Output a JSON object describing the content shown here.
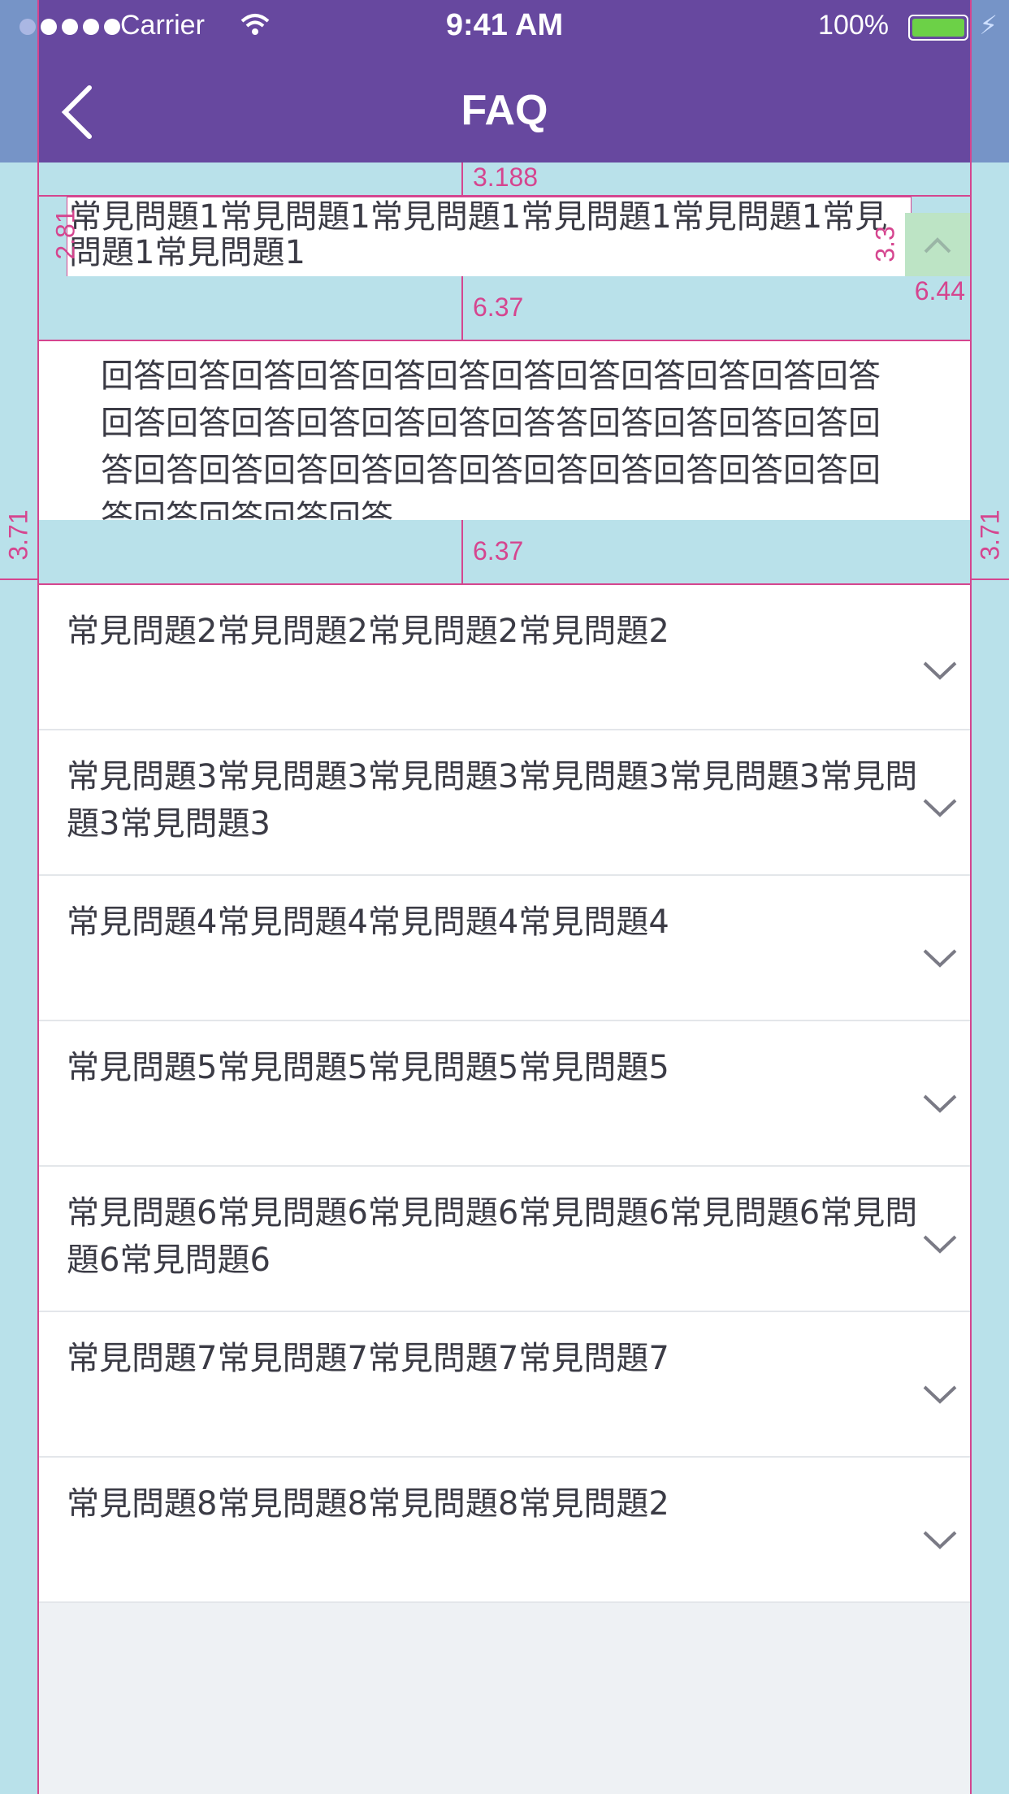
{
  "status_bar": {
    "carrier": "Carrier",
    "time": "9:41 AM",
    "battery": "100%"
  },
  "nav": {
    "title": "FAQ"
  },
  "icons": {
    "back": "chevron-left-icon",
    "wifi": "wifi-icon",
    "expand": "chevron-down-icon",
    "collapse": "chevron-up-icon",
    "charging": "bolt-icon"
  },
  "colors": {
    "header": "#67489f",
    "guide": "#b9e1ea",
    "measure": "#d5458f",
    "text": "#3b3b45"
  },
  "measures": {
    "top_gap": "3.188",
    "left_pad": "2.81",
    "right_pad": "3.3",
    "btn_gap": "6.44",
    "band1": "6.37",
    "band2": "6.37",
    "side_l": "3.71",
    "side_r": "3.71"
  },
  "faq": {
    "open_question": "常見問題1常見問題1常見問題1常見問題1常見問題1常見問題1常見問題1",
    "answer": "回答回答回答回答回答回答回答回答回答回答回答回答回答回答回答回答回答回答回答答回答回答回答回答回答回答回答回答回答回答回答回答回答回答回答回答回答回答回答回答回答",
    "items": [
      "常見問題2常見問題2常見問題2常見問題2",
      "常見問題3常見問題3常見問題3常見問題3常見問題3常見問題3常見問題3",
      "常見問題4常見問題4常見問題4常見問題4",
      "常見問題5常見問題5常見問題5常見問題5",
      "常見問題6常見問題6常見問題6常見問題6常見問題6常見問題6常見問題6",
      "常見問題7常見問題7常見問題7常見問題7",
      "常見問題8常見問題8常見問題8常見問題2"
    ]
  }
}
